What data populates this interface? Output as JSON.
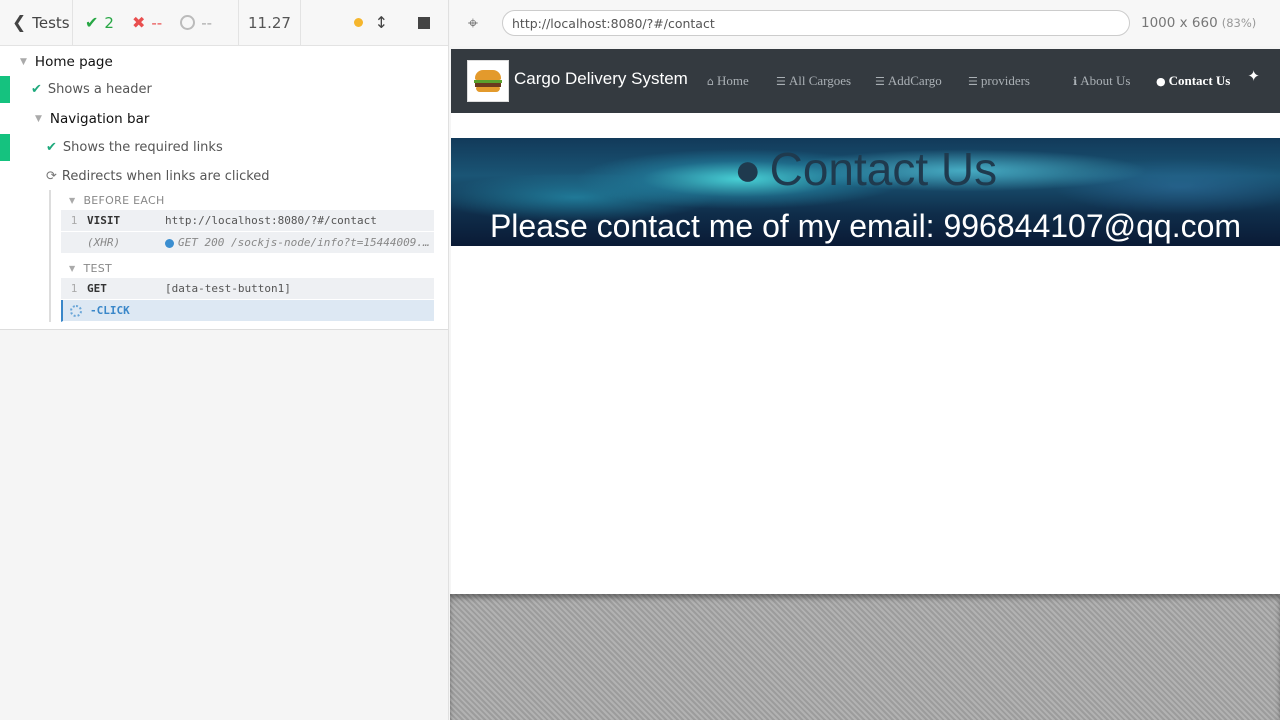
{
  "reporter": {
    "tests_label": "Tests",
    "passed_count": "2",
    "failed_count": "--",
    "pending_count": "--",
    "duration": "11.27",
    "colors": {
      "pass": "#28a745",
      "fail": "#e94f4f",
      "running": "#f5b62d"
    }
  },
  "runnables": {
    "suite_home": "Home page",
    "test_header": "Shows a header",
    "suite_nav": "Navigation bar",
    "test_links": "Shows the required links",
    "test_redirect": "Redirects when links are clicked",
    "before_each_title": "BEFORE EACH",
    "test_title": "TEST",
    "before_each_cmds": [
      {
        "num": "1",
        "name": "VISIT",
        "message": "http://localhost:8080/?#/contact"
      },
      {
        "num": "",
        "name": "(XHR)",
        "message": "GET 200 /sockjs-node/info?t=15444009..."
      }
    ],
    "test_cmds": [
      {
        "num": "1",
        "name": "GET",
        "message": "[data-test-button1]"
      },
      {
        "num": "",
        "name": "-CLICK",
        "message": ""
      }
    ]
  },
  "aut": {
    "url": "http://localhost:8080/?#/contact",
    "viewport": "1000 x 660",
    "scale": "(83%)"
  },
  "app": {
    "brand": "Cargo Delivery System",
    "nav": [
      {
        "icon": "home-icon",
        "label": "Home"
      },
      {
        "icon": "list-icon",
        "label": "All Cargoes"
      },
      {
        "icon": "list-icon",
        "label": "AddCargo"
      },
      {
        "icon": "list-icon",
        "label": "providers"
      },
      {
        "icon": "info-icon",
        "label": "About Us"
      },
      {
        "icon": "comment-icon",
        "label": "Contact Us"
      }
    ],
    "hero_title": "Contact Us",
    "hero_text": "Please contact me of my email: 996844107@qq.com"
  }
}
